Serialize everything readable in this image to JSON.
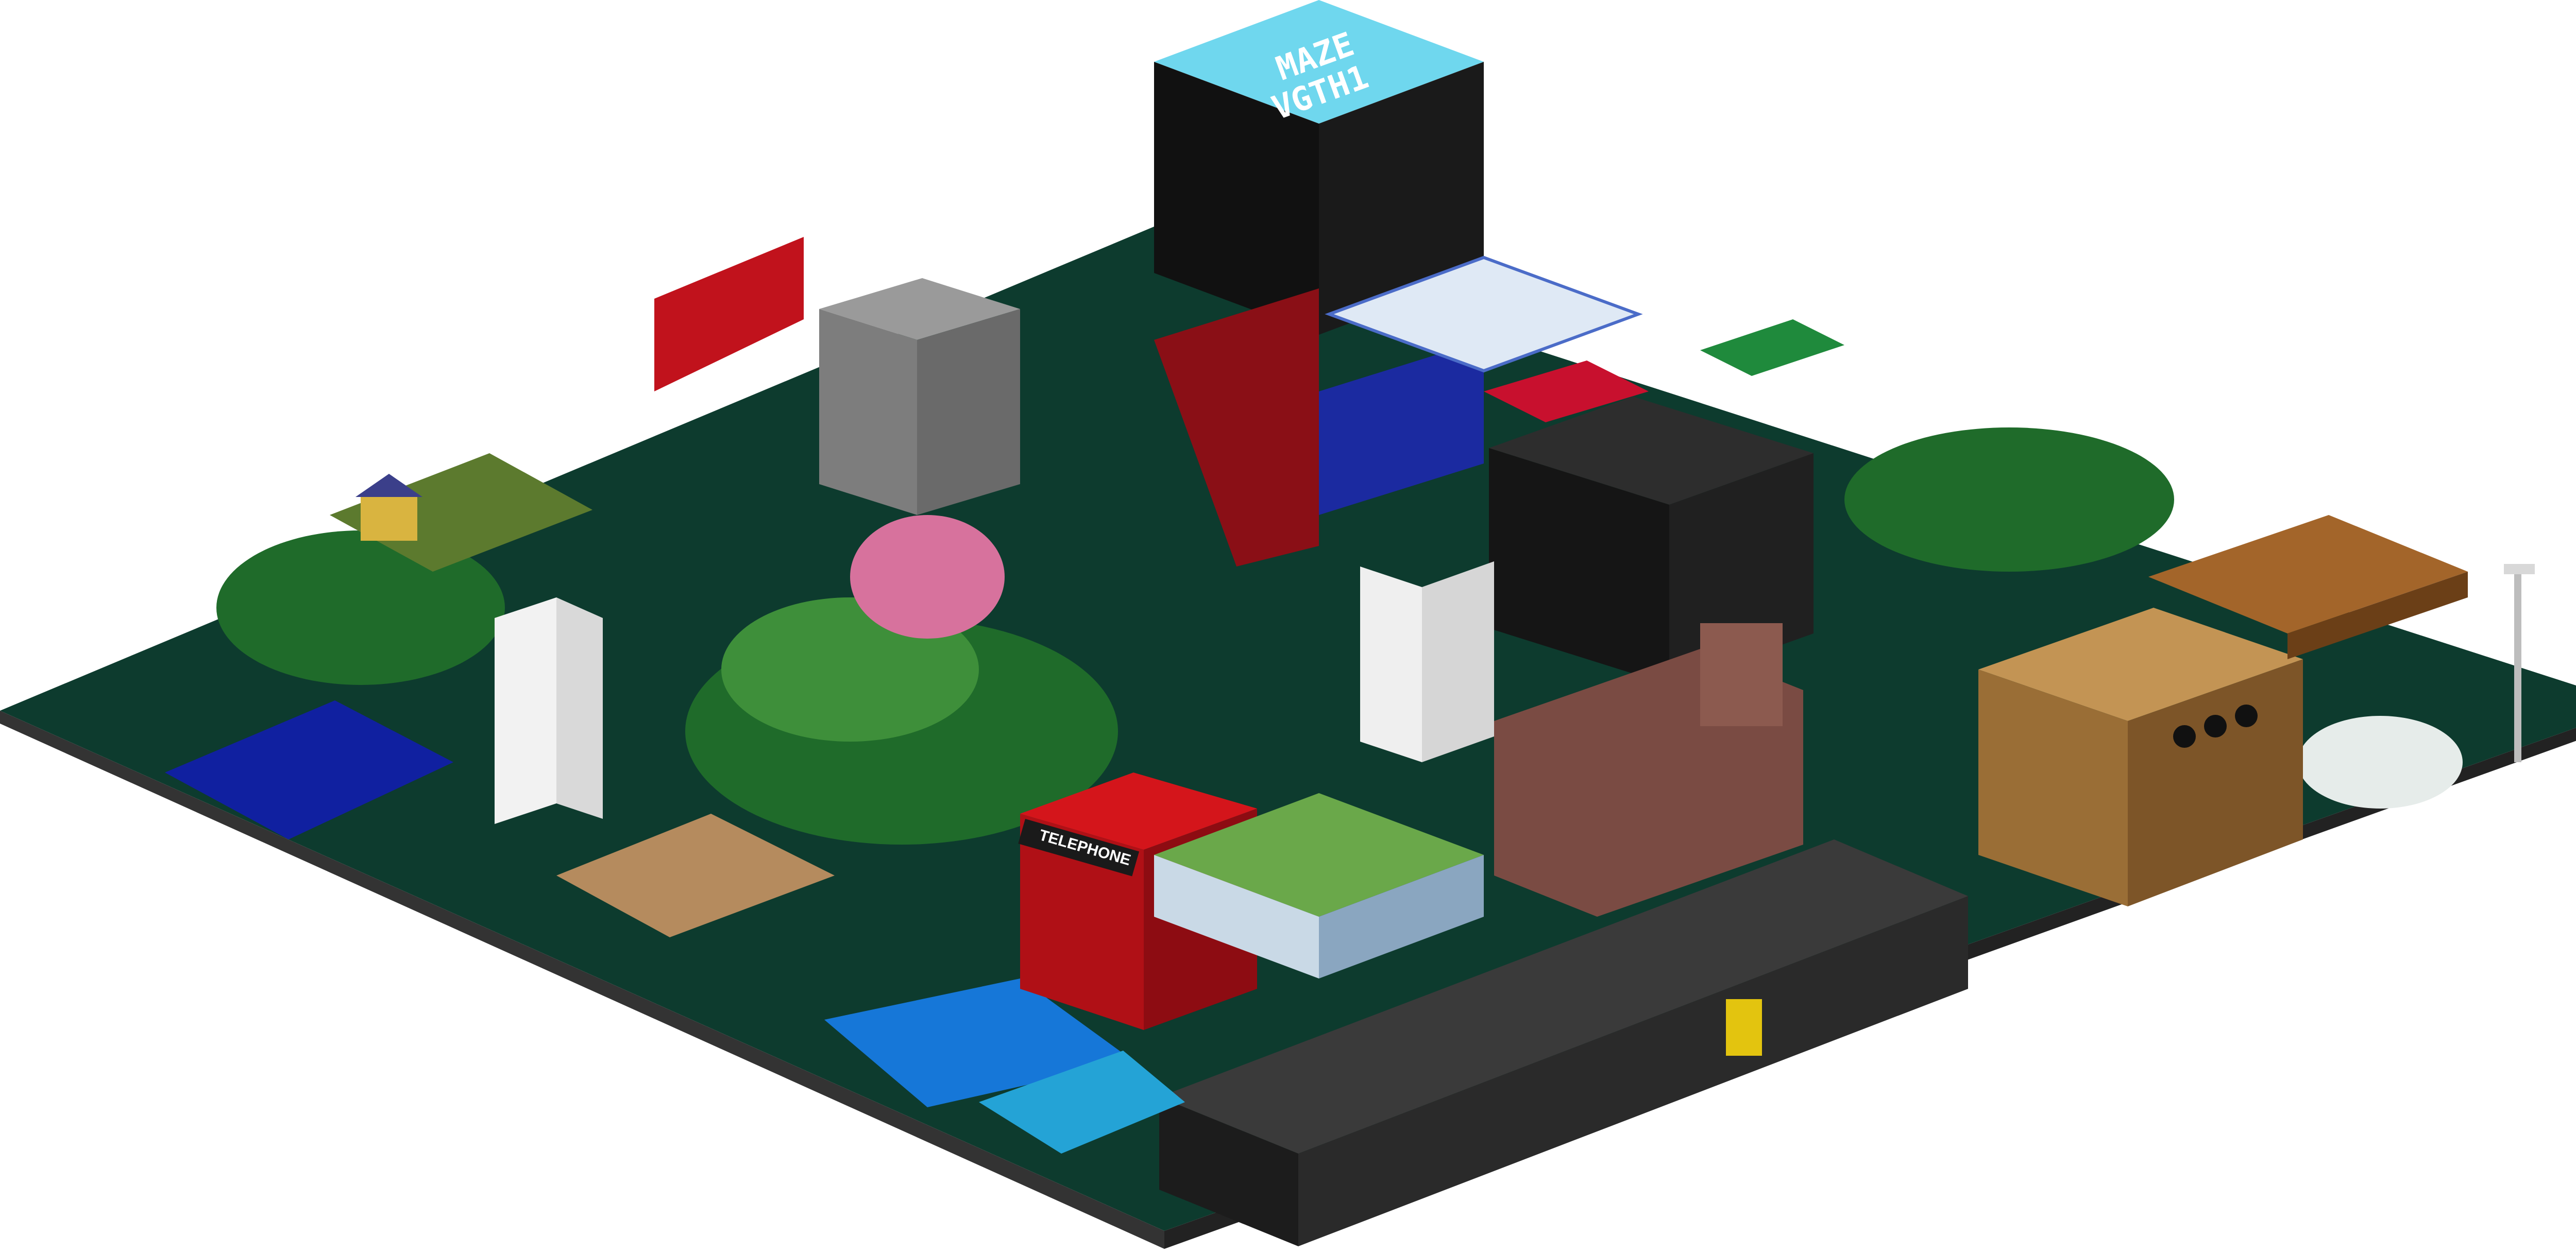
{
  "scene": {
    "description_kind": "isometric voxel city diorama",
    "colors": {
      "background": "#ffffff",
      "ground_dark": "#0d3b2e",
      "water": "#1677d8",
      "water_deep": "#1020a0",
      "forest": "#1f6b2a",
      "forest_light": "#3e8f3a",
      "cube_top": "#6fd7ee",
      "cube_side": "#111111",
      "telephone_red": "#d4151b",
      "pad_green": "#6aa84a",
      "bunker": "#2a2a2a",
      "cardboard": "#9a6e36",
      "brick": "#7a4b43",
      "flag_red": "#c8102e",
      "sakura": "#d7729d"
    }
  },
  "labels": {
    "cube_line1": "MAZE",
    "cube_line2": "VGTH1",
    "telephone": "TELEPHONE"
  }
}
